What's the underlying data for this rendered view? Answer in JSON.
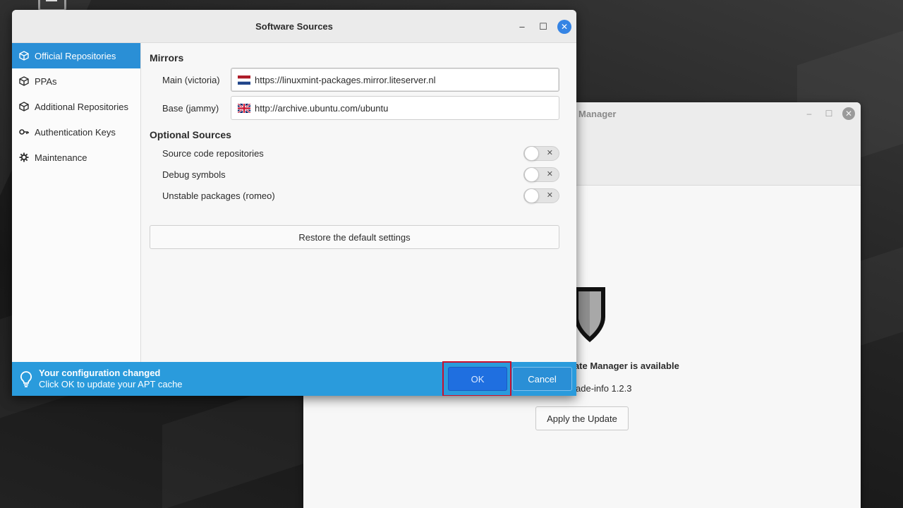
{
  "dialog": {
    "title": "Software Sources",
    "controls": {
      "minimize": "–",
      "maximize": "☐",
      "close": "✕"
    }
  },
  "sidebar": {
    "items": [
      {
        "label": "Official Repositories",
        "icon": "package-icon",
        "active": true
      },
      {
        "label": "PPAs",
        "icon": "package-icon",
        "active": false
      },
      {
        "label": "Additional Repositories",
        "icon": "package-icon",
        "active": false
      },
      {
        "label": "Authentication Keys",
        "icon": "key-icon",
        "active": false
      },
      {
        "label": "Maintenance",
        "icon": "gear-icon",
        "active": false
      }
    ]
  },
  "mirrors": {
    "heading": "Mirrors",
    "main_label": "Main (victoria)",
    "main_url": "https://linuxmint-packages.mirror.liteserver.nl",
    "main_flag": "netherlands-flag-icon",
    "base_label": "Base (jammy)",
    "base_url": "http://archive.ubuntu.com/ubuntu",
    "base_flag": "uk-flag-icon"
  },
  "optional": {
    "heading": "Optional Sources",
    "items": [
      {
        "label": "Source code repositories",
        "enabled": false
      },
      {
        "label": "Debug symbols",
        "enabled": false
      },
      {
        "label": "Unstable packages (romeo)",
        "enabled": false
      }
    ],
    "toggle_off_glyph": "✕"
  },
  "restore_label": "Restore the default settings",
  "infobar": {
    "title": "Your configuration changed",
    "subtitle": "Click OK to update your APT cache",
    "ok_label": "OK",
    "cancel_label": "Cancel",
    "background": "#2a9bdc"
  },
  "background_window": {
    "title": "Manager",
    "headline": "date Manager is available",
    "subtitle": "ade-info 1.2.3",
    "apply_label": "Apply the Update"
  },
  "colors": {
    "accent": "#2a8fd6",
    "ok_button": "#1f6fe0",
    "highlight_box": "#c8102e"
  }
}
